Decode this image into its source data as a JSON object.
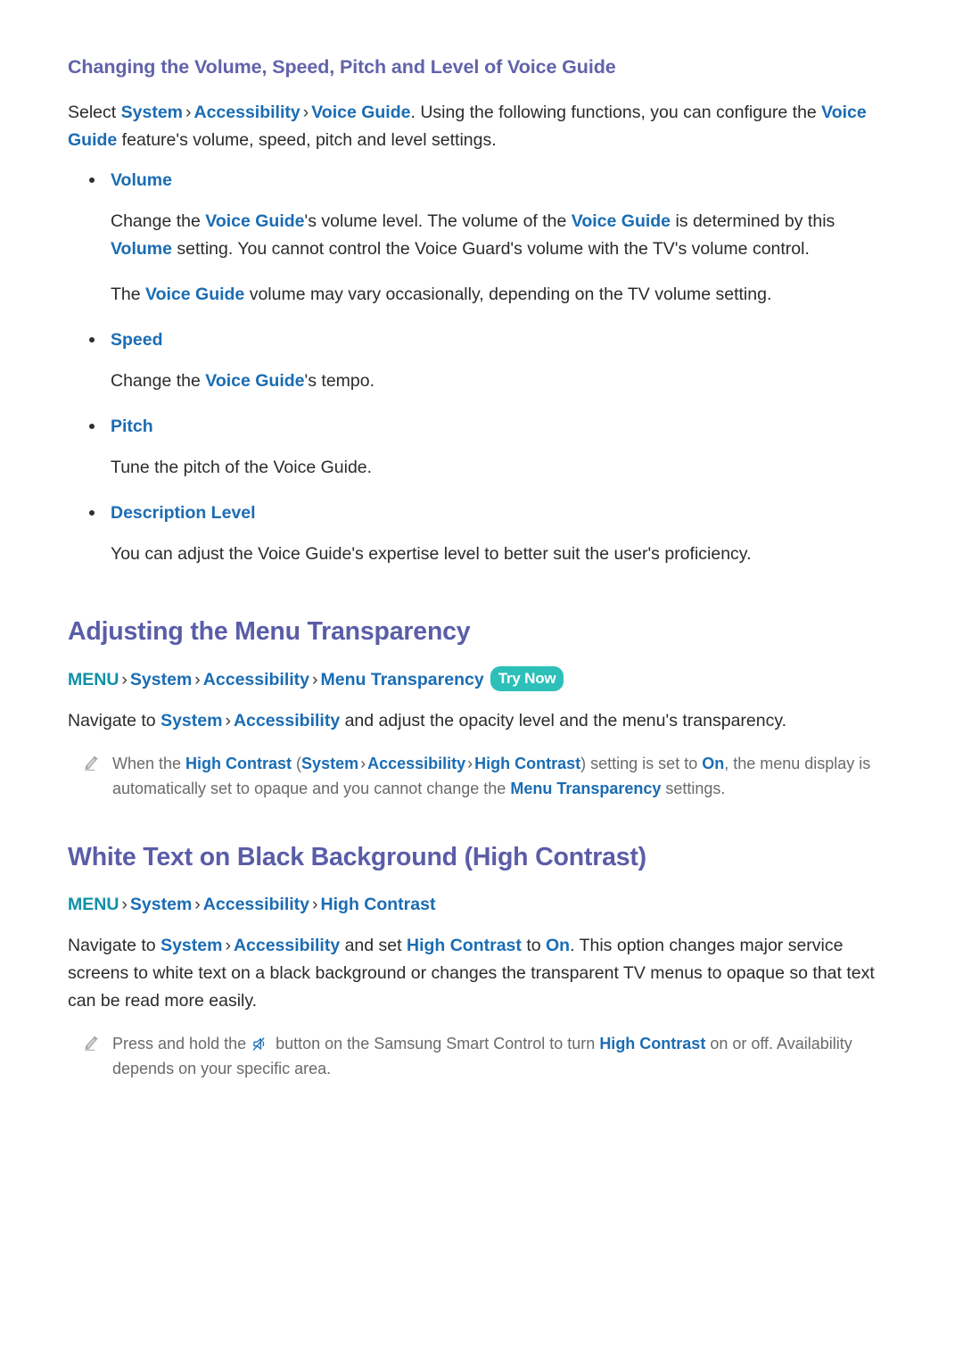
{
  "doc": {
    "sections": [
      {
        "id": "voice-guide-settings",
        "heading": "Changing the Volume, Speed, Pitch and Level of Voice Guide",
        "heading_level": "sub",
        "intro": {
          "lead": "Select ",
          "crumbs": [
            "System",
            "Accessibility",
            "Voice Guide"
          ],
          "after": ". Using the following functions, you can configure the ",
          "link2": "Voice Guide",
          "tail": " feature's volume, speed, pitch and level settings."
        },
        "bullets": [
          {
            "label": "Volume",
            "paragraphs": [
              {
                "parts": [
                  {
                    "t": "text",
                    "v": "Change the "
                  },
                  {
                    "t": "link",
                    "v": "Voice Guide"
                  },
                  {
                    "t": "text",
                    "v": "'s volume level. The volume of the "
                  },
                  {
                    "t": "link",
                    "v": "Voice Guide"
                  },
                  {
                    "t": "text",
                    "v": " is determined by this "
                  },
                  {
                    "t": "link",
                    "v": "Volume"
                  },
                  {
                    "t": "text",
                    "v": " setting. You cannot control the Voice Guard's volume with the TV's volume control."
                  }
                ]
              },
              {
                "parts": [
                  {
                    "t": "text",
                    "v": "The "
                  },
                  {
                    "t": "link",
                    "v": "Voice Guide"
                  },
                  {
                    "t": "text",
                    "v": " volume may vary occasionally, depending on the TV volume setting."
                  }
                ]
              }
            ]
          },
          {
            "label": "Speed",
            "paragraphs": [
              {
                "parts": [
                  {
                    "t": "text",
                    "v": "Change the "
                  },
                  {
                    "t": "link",
                    "v": "Voice Guide"
                  },
                  {
                    "t": "text",
                    "v": "'s tempo."
                  }
                ]
              }
            ]
          },
          {
            "label": "Pitch",
            "paragraphs": [
              {
                "parts": [
                  {
                    "t": "text",
                    "v": "Tune the pitch of the Voice Guide."
                  }
                ]
              }
            ]
          },
          {
            "label": "Description Level",
            "paragraphs": [
              {
                "parts": [
                  {
                    "t": "text",
                    "v": "You can adjust the Voice Guide's expertise level to better suit the user's proficiency."
                  }
                ]
              }
            ]
          }
        ]
      },
      {
        "id": "menu-transparency",
        "heading": "Adjusting the Menu Transparency",
        "heading_level": "main",
        "breadcrumb": {
          "root": "MENU",
          "items": [
            "System",
            "Accessibility",
            "Menu Transparency"
          ],
          "badge": "Try Now"
        },
        "body": {
          "parts": [
            {
              "t": "text",
              "v": "Navigate to "
            },
            {
              "t": "link",
              "v": "System"
            },
            {
              "t": "chev",
              "v": "›"
            },
            {
              "t": "link",
              "v": "Accessibility"
            },
            {
              "t": "text",
              "v": " and adjust the opacity level and the menu's transparency."
            }
          ]
        },
        "note": {
          "icon": "pencil-note-icon",
          "parts": [
            {
              "t": "text",
              "v": "When the "
            },
            {
              "t": "link",
              "v": "High Contrast"
            },
            {
              "t": "text",
              "v": " ("
            },
            {
              "t": "link",
              "v": "System"
            },
            {
              "t": "chev",
              "v": "›"
            },
            {
              "t": "link",
              "v": "Accessibility"
            },
            {
              "t": "chev",
              "v": "›"
            },
            {
              "t": "link",
              "v": "High Contrast"
            },
            {
              "t": "text",
              "v": ") setting is set to "
            },
            {
              "t": "link",
              "v": "On"
            },
            {
              "t": "text",
              "v": ", the menu display is automatically set to opaque and you cannot change the "
            },
            {
              "t": "link",
              "v": "Menu Transparency"
            },
            {
              "t": "text",
              "v": " settings."
            }
          ]
        }
      },
      {
        "id": "high-contrast",
        "heading": "White Text on Black Background (High Contrast)",
        "heading_level": "main",
        "breadcrumb": {
          "root": "MENU",
          "items": [
            "System",
            "Accessibility",
            "High Contrast"
          ],
          "badge": ""
        },
        "body": {
          "parts": [
            {
              "t": "text",
              "v": "Navigate to "
            },
            {
              "t": "link",
              "v": "System"
            },
            {
              "t": "chev",
              "v": "›"
            },
            {
              "t": "link",
              "v": "Accessibility"
            },
            {
              "t": "text",
              "v": " and set "
            },
            {
              "t": "link",
              "v": "High Contrast"
            },
            {
              "t": "text",
              "v": " to "
            },
            {
              "t": "link",
              "v": "On"
            },
            {
              "t": "text",
              "v": ". This option changes major service screens to white text on a black background or changes the transparent TV menus to opaque so that text can be read more easily."
            }
          ]
        },
        "note": {
          "icon": "pencil-note-icon",
          "parts": [
            {
              "t": "text",
              "v": "Press and hold the "
            },
            {
              "t": "glyph",
              "v": "mute-icon"
            },
            {
              "t": "text",
              "v": " button on the Samsung Smart Control to turn "
            },
            {
              "t": "link",
              "v": "High Contrast"
            },
            {
              "t": "text",
              "v": " on or off. Availability depends on your specific area."
            }
          ]
        }
      }
    ]
  },
  "colors": {
    "heading_purple": "#5a5da7",
    "link_blue": "#1a6cb4",
    "menu_teal": "#1090a6",
    "badge_teal": "#2cc0b9",
    "note_gray": "#6a6a6a",
    "body_text": "#2b2b2b",
    "page_bg": "#ffffff"
  }
}
